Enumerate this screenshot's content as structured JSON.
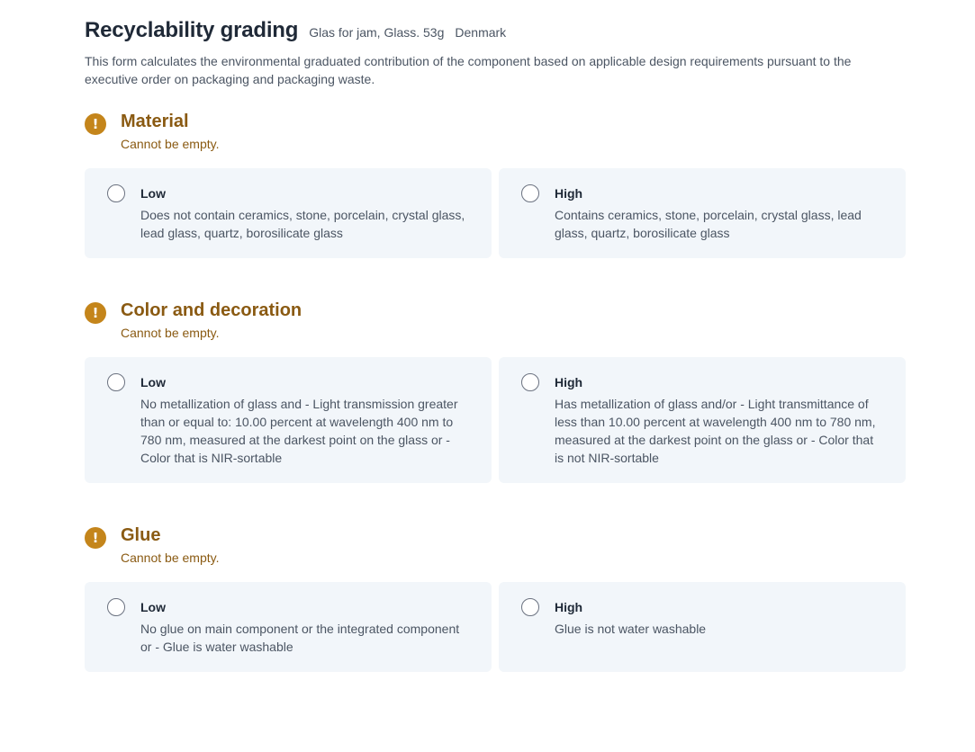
{
  "header": {
    "title": "Recyclability grading",
    "subtitle": "Glas for jam, Glass. 53g",
    "country": "Denmark",
    "description": "This form calculates the environmental graduated contribution of the component based on applicable design requirements pursuant to the executive order on packaging and packaging waste."
  },
  "colors": {
    "warning": "#c4851b",
    "warning_text": "#8a5a12",
    "card_bg": "#f2f6fa"
  },
  "sections": [
    {
      "title": "Material",
      "error": "Cannot be empty.",
      "icon": "warning-icon",
      "options": [
        {
          "label": "Low",
          "description": "Does not contain ceramics, stone, porcelain, crystal glass, lead glass, quartz, borosilicate glass"
        },
        {
          "label": "High",
          "description": "Contains ceramics, stone, porcelain, crystal glass, lead glass, quartz, borosilicate glass"
        }
      ]
    },
    {
      "title": "Color and decoration",
      "error": "Cannot be empty.",
      "icon": "warning-icon",
      "options": [
        {
          "label": "Low",
          "description": "No metallization of glass and - Light transmission greater than or equal to: 10.00 percent at wavelength 400 nm to 780 nm, measured at the darkest point on the glass or - Color that is NIR-sortable"
        },
        {
          "label": "High",
          "description": "Has metallization of glass and/or - Light transmittance of less than 10.00 percent at wavelength 400 nm to 780 nm, measured at the darkest point on the glass or - Color that is not NIR-sortable"
        }
      ]
    },
    {
      "title": "Glue",
      "error": "Cannot be empty.",
      "icon": "warning-icon",
      "options": [
        {
          "label": "Low",
          "description": "No glue on main component or the integrated component or - Glue is water washable"
        },
        {
          "label": "High",
          "description": "Glue is not water washable"
        }
      ]
    }
  ]
}
